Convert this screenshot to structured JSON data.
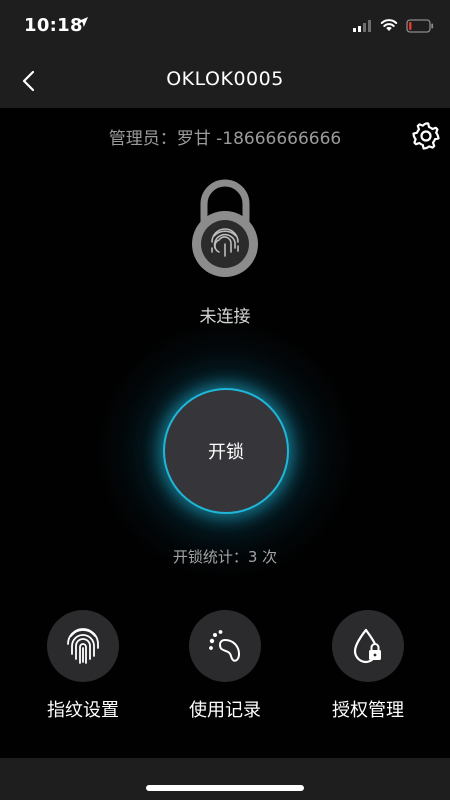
{
  "status_bar": {
    "time": "10:18",
    "icons": [
      "location-arrow-icon",
      "cellular-signal-icon",
      "wifi-icon",
      "battery-icon"
    ]
  },
  "nav": {
    "title": "OKLOK0005",
    "back_icon": "chevron-left-icon"
  },
  "admin": {
    "text": "管理员：罗甘 -18666666666",
    "settings_icon": "gear-icon"
  },
  "lock": {
    "icon": "fingerprint-padlock-icon",
    "status": "未连接"
  },
  "unlock": {
    "label": "开锁",
    "count_text": "开锁统计：3 次"
  },
  "actions": [
    {
      "label": "指纹设置",
      "icon": "fingerprint-icon"
    },
    {
      "label": "使用记录",
      "icon": "footprint-icon"
    },
    {
      "label": "授权管理",
      "icon": "drop-lock-icon"
    }
  ],
  "colors": {
    "accent": "#1fb6d8",
    "bar_background": "#1e1e1f",
    "button_fill": "#36363a"
  }
}
